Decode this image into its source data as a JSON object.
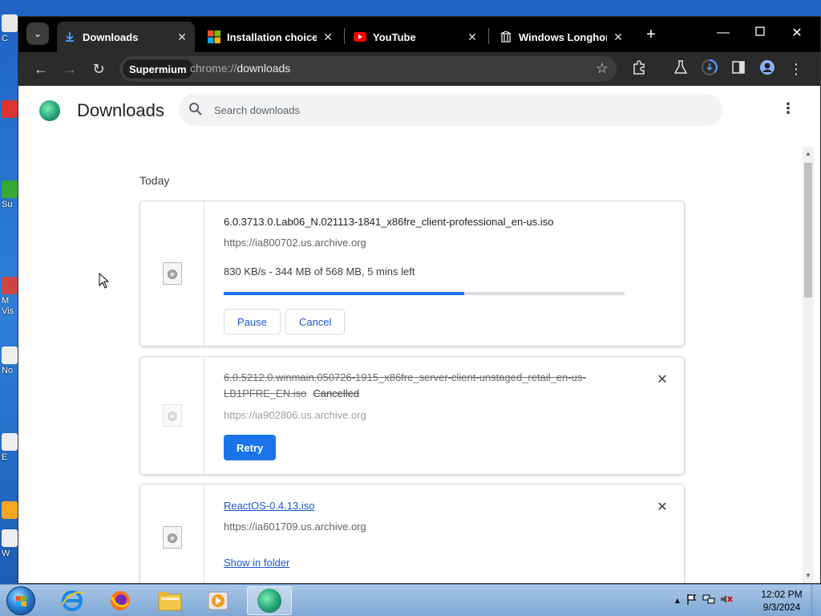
{
  "desktop": {
    "icons": [
      {
        "label": "C",
        "color": "#e8e8e8"
      },
      {
        "label": "",
        "color": "#d33"
      },
      {
        "label": "Su",
        "color": "#3a3"
      },
      {
        "label": "M\nVis",
        "color": "#c44"
      },
      {
        "label": "No",
        "color": "#eee"
      },
      {
        "label": "E",
        "color": "#eee"
      },
      {
        "label": "",
        "color": "#f5a623"
      },
      {
        "label": "W",
        "color": "#eee"
      }
    ]
  },
  "browser": {
    "tabs": [
      {
        "title": "Downloads",
        "icon": "download-icon",
        "active": true
      },
      {
        "title": "Installation choices |",
        "icon": "windows-logo-icon",
        "active": false
      },
      {
        "title": "YouTube",
        "icon": "youtube-icon",
        "active": false
      },
      {
        "title": "Windows Longhorn",
        "icon": "archive-icon",
        "active": false
      }
    ],
    "omnibox": {
      "chip": "Supermium",
      "scheme": "chrome://",
      "path": "downloads"
    }
  },
  "downloads_page": {
    "title": "Downloads",
    "search_placeholder": "Search downloads",
    "date_group": "Today",
    "items": [
      {
        "filename": "6.0.3713.0.Lab06_N.021113-1841_x86fre_client-professional_en-us.iso",
        "url": "https://ia800702.us.archive.org",
        "status": "830 KB/s - 344 MB of 568 MB, 5 mins left",
        "progress": 0.6,
        "buttons": [
          "Pause",
          "Cancel"
        ]
      },
      {
        "filename": "6.0.5212.0.winmain.050726-1915_x86fre_server-client-unstaged_retail_en-us-LB1PFRE_EN.iso",
        "state": "Cancelled",
        "url": "https://ia902806.us.archive.org",
        "button": "Retry"
      },
      {
        "filename": "ReactOS-0.4.13.iso",
        "url": "https://ia601709.us.archive.org",
        "link": "Show in folder"
      }
    ]
  },
  "taskbar": {
    "apps": [
      {
        "icon": "internet-explorer-icon",
        "active": false
      },
      {
        "icon": "firefox-icon",
        "active": false
      },
      {
        "icon": "file-explorer-icon",
        "active": false
      },
      {
        "icon": "media-player-icon",
        "active": false
      },
      {
        "icon": "supermium-icon",
        "active": true
      }
    ],
    "clock": {
      "time": "12:02 PM",
      "date": "9/3/2024"
    }
  }
}
